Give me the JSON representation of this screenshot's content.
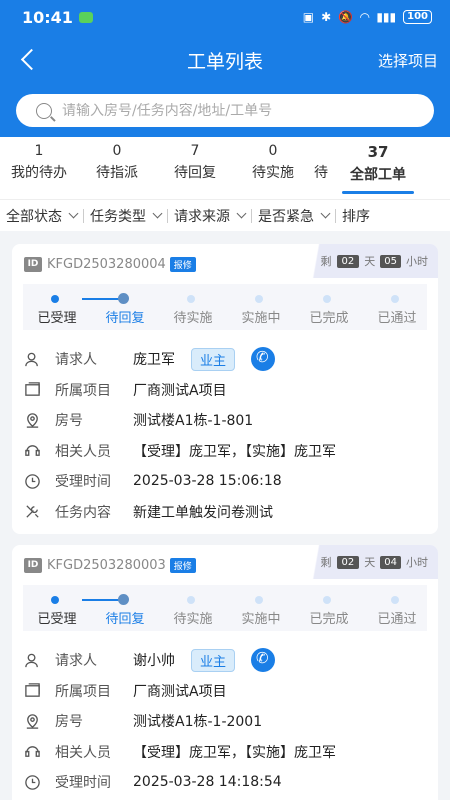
{
  "status": {
    "time": "10:41",
    "battery": "100"
  },
  "header": {
    "title": "工单列表",
    "right_action": "选择项目"
  },
  "search": {
    "placeholder": "请输入房号/任务内容/地址/工单号"
  },
  "tabs": [
    {
      "count": "1",
      "label": "我的待办"
    },
    {
      "count": "0",
      "label": "待指派"
    },
    {
      "count": "7",
      "label": "待回复"
    },
    {
      "count": "0",
      "label": "待实施"
    },
    {
      "count": "",
      "label": "待"
    },
    {
      "count": "37",
      "label": "全部工单"
    }
  ],
  "filters": [
    "全部状态",
    "任务类型",
    "请求来源",
    "是否紧急",
    "排序"
  ],
  "steps": [
    "已受理",
    "待回复",
    "待实施",
    "实施中",
    "已完成",
    "已通过"
  ],
  "labels": {
    "requester": "请求人",
    "project": "所属项目",
    "room": "房号",
    "people": "相关人员",
    "time": "受理时间",
    "content": "任务内容",
    "remain": "剩",
    "day": "天",
    "hour": "小时",
    "tag": "报修",
    "owner": "业主"
  },
  "orders": [
    {
      "no": "KFGD2503280004",
      "days": "02",
      "hours": "05",
      "requester": "庞卫军",
      "project": "厂商测试A项目",
      "room": "测试楼A1栋-1-801",
      "people": "【受理】庞卫军，【实施】庞卫军",
      "time": "2025-03-28 15:06:18",
      "content": "新建工单触发问卷测试"
    },
    {
      "no": "KFGD2503280003",
      "days": "02",
      "hours": "04",
      "requester": "谢小帅",
      "project": "厂商测试A项目",
      "room": "测试楼A1栋-1-2001",
      "people": "【受理】庞卫军，【实施】庞卫军",
      "time": "2025-03-28 14:18:54"
    }
  ],
  "colors": {
    "primary": "#1a7ee6"
  }
}
